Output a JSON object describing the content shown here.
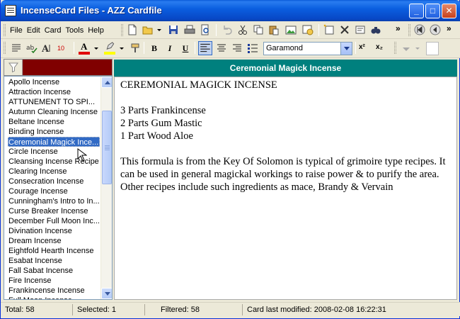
{
  "window": {
    "title": "IncenseCard Files - AZZ Cardfile"
  },
  "menu": [
    "File",
    "Edit",
    "Card",
    "Tools",
    "Help"
  ],
  "toolbar2": {
    "font_size": "10",
    "bold": "B",
    "italic": "I",
    "underline": "U",
    "font_name": "Garamond",
    "superscript": "x²",
    "subscript": "x₂"
  },
  "list": {
    "items": [
      "Apollo Incense",
      "Attraction Incense",
      "ATTUNEMENT TO SPI...",
      "Autumn Cleaning Incense",
      "Beltane Incense",
      "Binding Incense",
      "Ceremonial Magick Ince...",
      "Circle Incense",
      "Cleansing Incense Recipe",
      "Clearing Incense",
      "Consecration Incense",
      "Courage Incense",
      "Cunningham's Intro to In...",
      "Curse Breaker Incense",
      "December Full Moon Inc...",
      "Divination Incense",
      "Dream Incense",
      "Eightfold Hearth Incense",
      "Esabat Incense",
      "Fall Sabat Incense",
      "Fire Incense",
      "Frankincense Incense",
      "Full Moon Incense"
    ],
    "selected_index": 6
  },
  "card": {
    "header": "Ceremonial Magick Incense",
    "lines": [
      "CEREMONIAL MAGICK INCENSE",
      "",
      "3 Parts Frankincense",
      "2 Parts Gum Mastic",
      "1 Part Wood Aloe",
      "",
      "This formula is from the Key Of Solomon is typical of grimoire type recipes. It",
      "can be used in general magickal workings to raise power & to purify the area.",
      "Other recipes include such ingredients as mace, Brandy & Vervain"
    ]
  },
  "status": {
    "total": "Total: 58",
    "selected": "Selected: 1",
    "filtered": "Filtered: 58",
    "modified": "Card last modified: 2008-02-08  16:22:31"
  },
  "colors": {
    "accent": "#00807e",
    "filter_bar": "#800000",
    "selection": "#316ac5",
    "titlebar": "#0b5fe0"
  }
}
